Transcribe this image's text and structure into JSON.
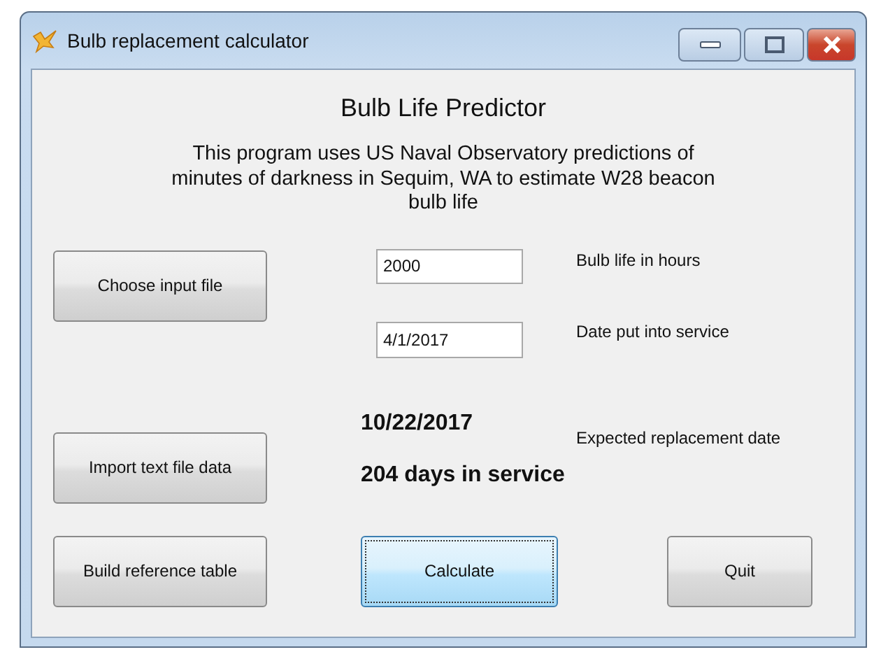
{
  "window": {
    "title": "Bulb replacement calculator"
  },
  "heading": "Bulb Life Predictor",
  "description": "This program uses US Naval Observatory predictions of minutes of darkness in Sequim, WA to estimate W28 beacon bulb life",
  "side_buttons": [
    {
      "label": "Choose input file",
      "focused": false
    },
    {
      "label": "Import text file data",
      "focused": false
    }
  ],
  "fields": [
    {
      "value": "2000",
      "label": "Bulb life in hours"
    },
    {
      "value": "4/1/2017",
      "label": "Date put into service"
    }
  ],
  "result": {
    "date": "10/22/2017",
    "days": "204 days in service",
    "label": "Expected replacement date"
  },
  "bottom_buttons": [
    {
      "label": "Build reference table",
      "focused": false
    },
    {
      "label": "Calculate",
      "focused": true
    },
    {
      "label": "Quit",
      "focused": false
    }
  ]
}
